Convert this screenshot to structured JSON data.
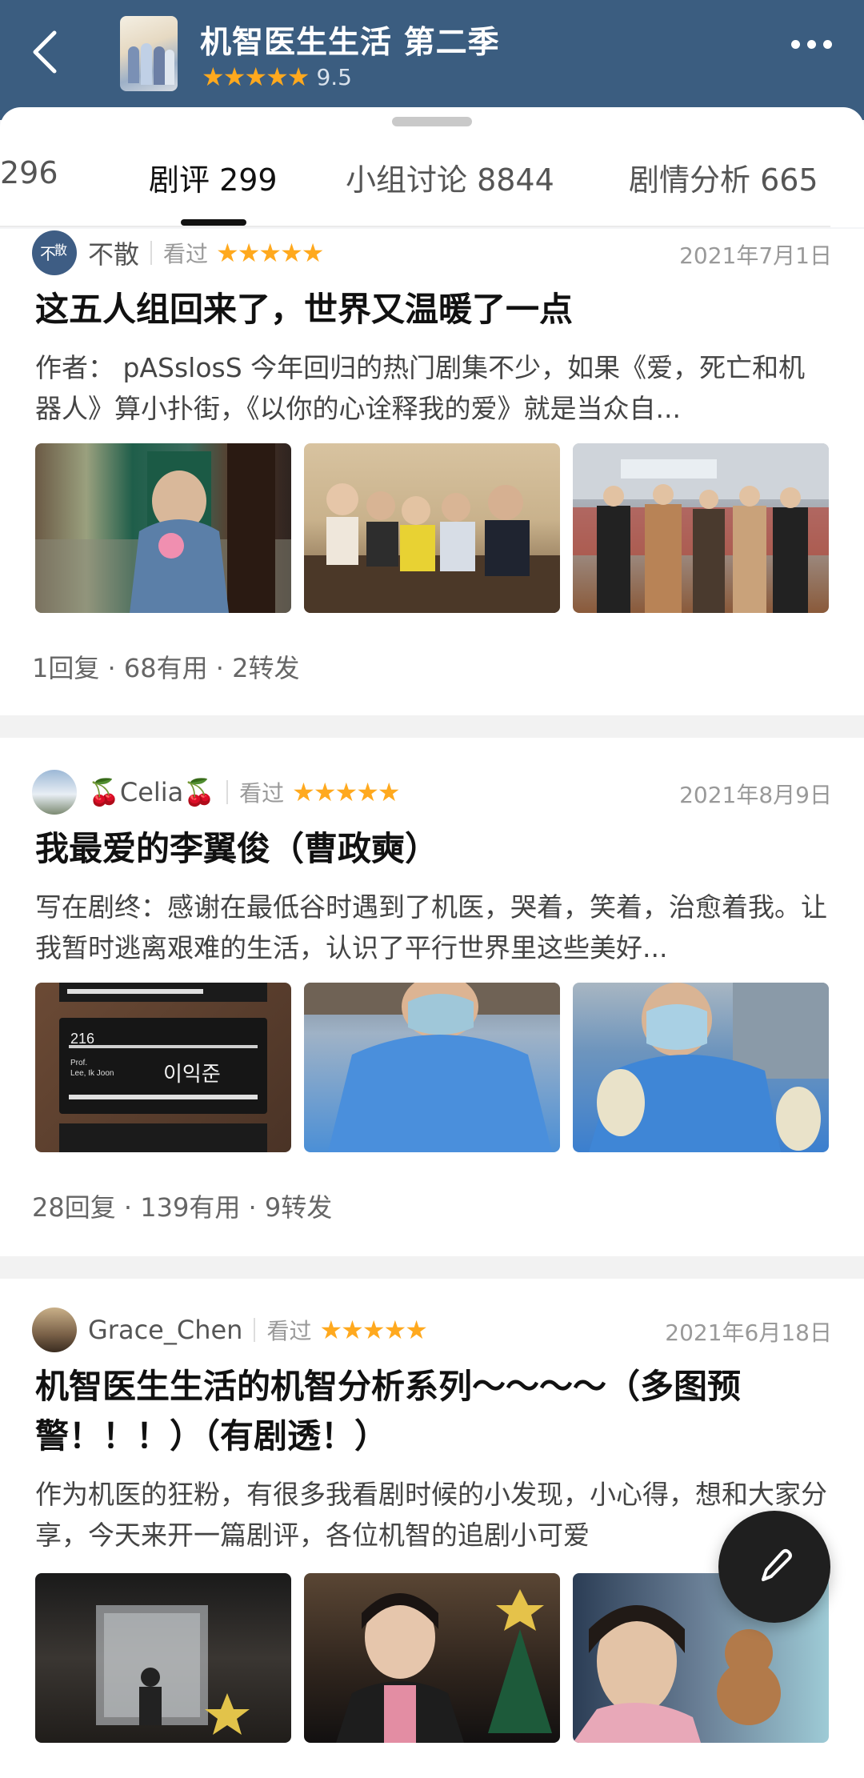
{
  "header": {
    "title": "机智医生生活 第二季",
    "stars": "★★★★★",
    "score": "9.5"
  },
  "tabs": [
    {
      "label": "296"
    },
    {
      "label": "剧评 299"
    },
    {
      "label": "小组讨论 8844"
    },
    {
      "label": "剧情分析 665"
    }
  ],
  "active_tab": 1,
  "reviews": [
    {
      "author": "不散",
      "status": "看过",
      "stars": "★★★★★",
      "rating": 5,
      "date": "2021年7月1日",
      "title": "这五人组回来了，世界又温暖了一点",
      "excerpt": "作者： pASslosS 今年回归的热门剧集不少，如果《爱，死亡和机器人》算小扑街，《以你的心诠释我的爱》就是当众自...",
      "stats": "1回复 · 68有用 · 2转发"
    },
    {
      "author": "🍒Celia🍒",
      "status": "看过",
      "stars": "★★★★★",
      "rating": 5,
      "date": "2021年8月9日",
      "title": "我最爱的李翼俊（曹政奭）",
      "excerpt": "写在剧终：感谢在最低谷时遇到了机医，哭着，笑着，治愈着我。让我暂时逃离艰难的生活，认识了平行世界里这些美好...",
      "stats": "28回复 · 139有用 · 9转发",
      "thumb_sign": {
        "number": "216",
        "name": "이익준",
        "en": "Prof.\nLee, Ik Joon"
      }
    },
    {
      "author": "Grace_Chen",
      "status": "看过",
      "stars": "★★★★★",
      "rating": 5,
      "date": "2021年6月18日",
      "title": "机智医生生活的机智分析系列～～～～（多图预警！！！）（有剧透！）",
      "excerpt": "作为机医的狂粉，有很多我看剧时候的小发现，小心得，想和大家分享，今天来开一篇剧评，各位机智的追剧小可爱",
      "stats": ""
    }
  ],
  "colors": {
    "header_bg": "#3b5d80",
    "star": "#ffa91e"
  }
}
